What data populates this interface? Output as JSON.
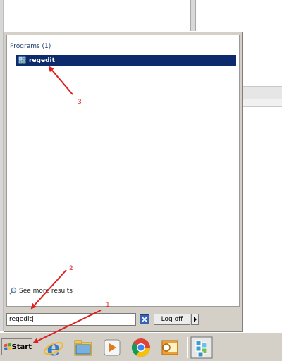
{
  "start_menu": {
    "programs_header": "Programs (1)",
    "results": [
      {
        "label": "regedit",
        "icon": "regedit-icon"
      }
    ],
    "see_more": "See more results",
    "search": {
      "value": "regedit|"
    },
    "logoff_label": "Log off"
  },
  "taskbar": {
    "start_label": "Start",
    "pinned": [
      "internet-explorer-icon",
      "file-explorer-icon",
      "media-player-icon",
      "chrome-icon",
      "outlook-icon",
      "registry-editor-icon"
    ]
  },
  "annotations": [
    {
      "label": "1"
    },
    {
      "label": "2"
    },
    {
      "label": "3"
    }
  ],
  "colors": {
    "highlight": "#0d2a6d",
    "annotation": "#e02020",
    "chrome_gray": "#d4d0c8"
  }
}
